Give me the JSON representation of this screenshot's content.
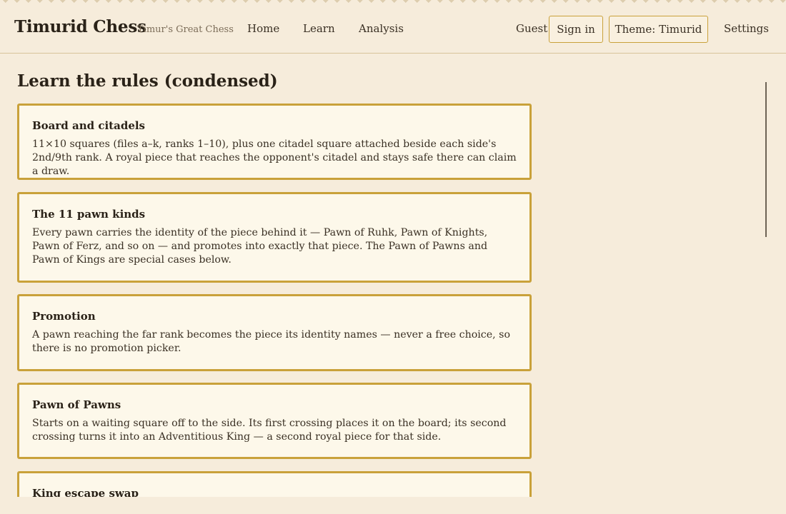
{
  "header": {
    "brand": "Timurid Chess",
    "tagline": "Timur's Great Chess",
    "nav": [
      "Home",
      "Learn",
      "Analysis"
    ],
    "user": "Guest",
    "signin_label": "Sign in",
    "theme_label": "Theme: Timurid",
    "settings_label": "Settings"
  },
  "page": {
    "title": "Learn the rules (condensed)"
  },
  "cards": [
    {
      "title": "Board and citadels",
      "body": "11×10 squares (files a–k, ranks 1–10), plus one citadel square attached beside each side's 2nd/9th rank. A royal piece that reaches the opponent's citadel and stays safe there can claim a draw."
    },
    {
      "title": "The 11 pawn kinds",
      "body": "Every pawn carries the identity of the piece behind it — Pawn of Ruhk, Pawn of Knights, Pawn of Ferz, and so on — and promotes into exactly that piece. The Pawn of Pawns and Pawn of Kings are special cases below."
    },
    {
      "title": "Promotion",
      "body": "A pawn reaching the far rank becomes the piece its identity names — never a free choice, so there is no promotion picker."
    },
    {
      "title": "Pawn of Pawns",
      "body": "Starts on a waiting square off to the side. Its first crossing places it on the board; its second crossing turns it into an Adventitious King — a second royal piece for that side."
    },
    {
      "title": "King escape swap",
      "body": ""
    }
  ],
  "colors": {
    "background": "#f6ecdb",
    "card_bg": "#fdf8ea",
    "accent_border": "#c9a13a",
    "text": "#2a2218"
  }
}
